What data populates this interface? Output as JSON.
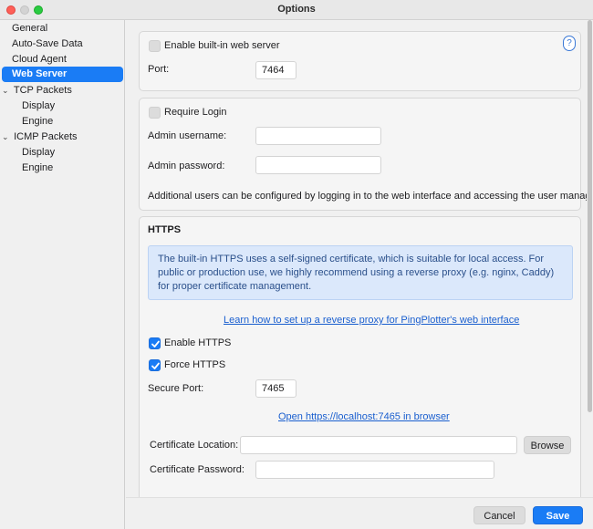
{
  "window": {
    "title": "Options"
  },
  "sidebar": {
    "items": [
      {
        "label": "General",
        "indent": 0,
        "expandable": false,
        "selected": false
      },
      {
        "label": "Auto-Save Data",
        "indent": 0,
        "expandable": false,
        "selected": false
      },
      {
        "label": "Cloud Agent",
        "indent": 0,
        "expandable": false,
        "selected": false
      },
      {
        "label": "Web Server",
        "indent": 0,
        "expandable": false,
        "selected": true
      },
      {
        "label": "TCP Packets",
        "indent": 0,
        "expandable": true,
        "selected": false
      },
      {
        "label": "Display",
        "indent": 1,
        "expandable": false,
        "selected": false
      },
      {
        "label": "Engine",
        "indent": 1,
        "expandable": false,
        "selected": false
      },
      {
        "label": "ICMP Packets",
        "indent": 0,
        "expandable": true,
        "selected": false
      },
      {
        "label": "Display",
        "indent": 1,
        "expandable": false,
        "selected": false
      },
      {
        "label": "Engine",
        "indent": 1,
        "expandable": false,
        "selected": false
      }
    ]
  },
  "web_server": {
    "enable_label": "Enable built-in web server",
    "enable_checked": false,
    "port_label": "Port:",
    "port_value": "7464",
    "help_label": "?"
  },
  "login": {
    "require_label": "Require Login",
    "require_checked": false,
    "username_label": "Admin username:",
    "username_value": "",
    "password_label": "Admin password:",
    "password_value": "",
    "note": "Additional users can be configured by logging in to the web interface and accessing the user manager."
  },
  "https": {
    "heading": "HTTPS",
    "info": "The built-in HTTPS uses a self-signed certificate, which is suitable for local access. For public or production use, we highly recommend using a reverse proxy (e.g. nginx, Caddy) for proper certificate management.",
    "learn_link": "Learn how to set up a reverse proxy for PingPlotter's web interface",
    "enable_label": "Enable HTTPS",
    "enable_checked": true,
    "force_label": "Force HTTPS",
    "force_checked": true,
    "secure_port_label": "Secure Port:",
    "secure_port_value": "7465",
    "open_link": "Open https://localhost:7465 in browser",
    "cert_location_label": "Certificate Location:",
    "cert_location_value": "",
    "browse_label": "Browse",
    "cert_password_label": "Certificate Password:",
    "cert_password_value": ""
  },
  "footer": {
    "cancel_label": "Cancel",
    "save_label": "Save"
  },
  "colors": {
    "accent": "#1a7cf5",
    "info_bg": "#dbe8fb",
    "info_text": "#2a4f8a",
    "link": "#1a5fcf"
  }
}
